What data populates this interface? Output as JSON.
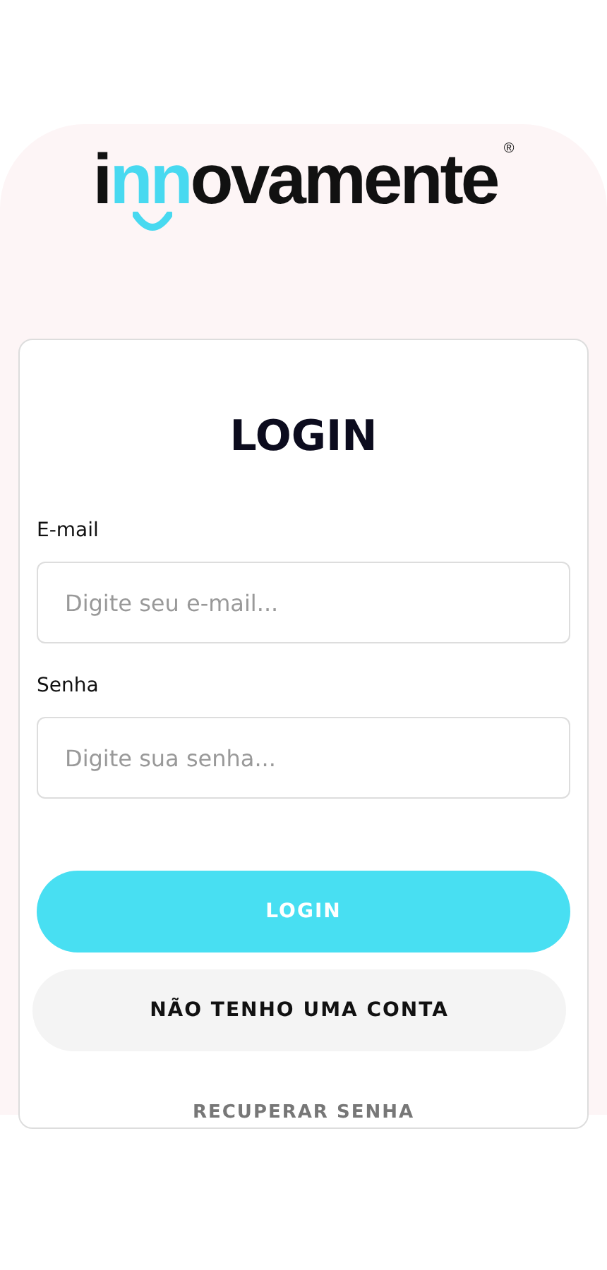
{
  "logo": {
    "parts": [
      {
        "text": "i",
        "accent": false
      },
      {
        "text": "nn",
        "accent": true
      },
      {
        "text": "ovamente",
        "accent": false
      }
    ],
    "registered": "®"
  },
  "login": {
    "title": "LOGIN",
    "fields": [
      {
        "label": "E-mail",
        "placeholder": "Digite seu e-mail..."
      },
      {
        "label": "Senha",
        "placeholder": "Digite sua senha..."
      }
    ],
    "buttons": [
      {
        "label": "LOGIN",
        "kind": "primary"
      },
      {
        "label": "NÃO TENHO UMA CONTA",
        "kind": "secondary"
      }
    ],
    "recover_link": "RECUPERAR SENHA"
  }
}
